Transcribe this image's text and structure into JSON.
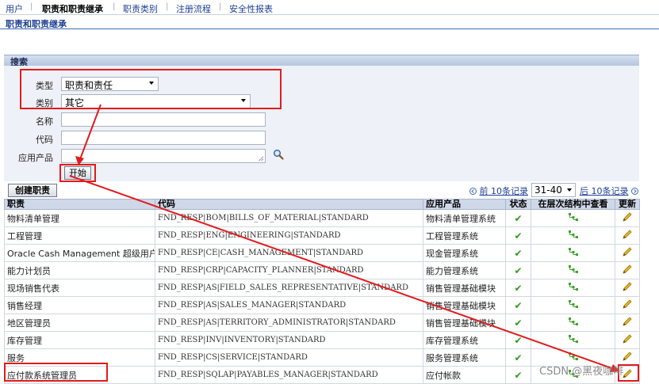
{
  "nav": {
    "tabs": [
      "用户",
      "职责和职责继承",
      "职责类别",
      "注册流程",
      "安全性报表"
    ],
    "active": 1
  },
  "breadcrumb": "职责和职责继承",
  "search": {
    "header": "搜索",
    "type_label": "类型",
    "type_value": "职责和责任",
    "category_label": "类别",
    "category_value": "其它",
    "name_label": "名称",
    "code_label": "代码",
    "app_label": "应用产品",
    "go_label": "开始"
  },
  "toolbar": {
    "create_label": "创建职责",
    "prev_label": "前 10条记录",
    "range_value": "31-40",
    "next_label": "后 10条记录"
  },
  "table": {
    "headers": [
      "职责",
      "代码",
      "应用产品",
      "状态",
      "在层次结构中查看",
      "更新"
    ],
    "rows": [
      {
        "name": "物料清单管理",
        "code": "FND_RESP|BOM|BILLS_OF_MATERIAL|STANDARD",
        "app": "物料清单管理系统"
      },
      {
        "name": "工程管理",
        "code": "FND_RESP|ENG|ENGINEERING|STANDARD",
        "app": "工程管理系统"
      },
      {
        "name": "Oracle Cash Management 超级用户",
        "code": "FND_RESP|CE|CASH_MANAGEMENT|STANDARD",
        "app": "现金管理系统"
      },
      {
        "name": "能力计划员",
        "code": "FND_RESP|CRP|CAPACITY_PLANNER|STANDARD",
        "app": "能力管理系统"
      },
      {
        "name": "现场销售代表",
        "code": "FND_RESP|AS|FIELD_SALES_REPRESENTATIVE|STANDARD",
        "app": "销售管理基础模块"
      },
      {
        "name": "销售经理",
        "code": "FND_RESP|AS|SALES_MANAGER|STANDARD",
        "app": "销售管理基础模块"
      },
      {
        "name": "地区管理员",
        "code": "FND_RESP|AS|TERRITORY_ADMINISTRATOR|STANDARD",
        "app": "销售管理基础模块"
      },
      {
        "name": "库存管理",
        "code": "FND_RESP|INV|INVENTORY|STANDARD",
        "app": "库存管理系统"
      },
      {
        "name": "服务",
        "code": "FND_RESP|CS|SERVICE|STANDARD",
        "app": "服务管理系统"
      },
      {
        "name": "应付款系统管理员",
        "code": "FND_RESP|SQLAP|PAYABLES_MANAGER|STANDARD",
        "app": "应付帐款"
      }
    ]
  },
  "watermark": "CSDN @黑夜咖啡",
  "colors": {
    "accent": "#1c3f94",
    "highlight": "#e21b1b",
    "check": "#2f9a1f",
    "update": "#e0b020"
  },
  "icons": [
    "magnifier-icon",
    "checkmark-icon",
    "hierarchy-icon",
    "pencil-icon"
  ]
}
